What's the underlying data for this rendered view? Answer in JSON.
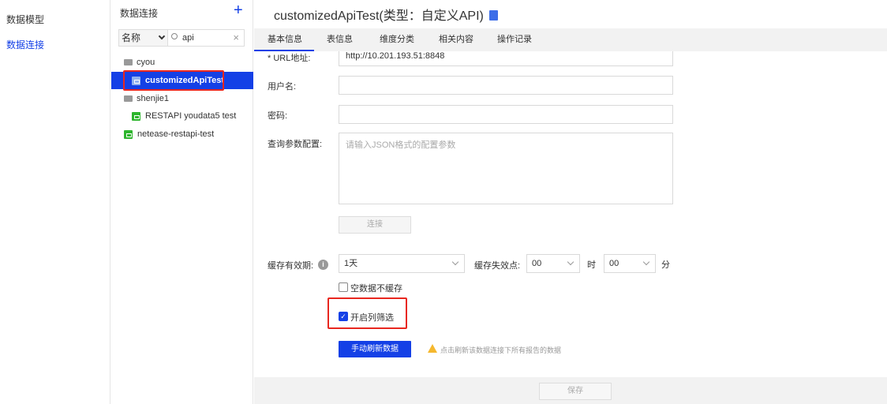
{
  "nav": {
    "items": [
      {
        "label": "数据模型",
        "active": false
      },
      {
        "label": "数据连接",
        "active": true
      }
    ]
  },
  "tree": {
    "title": "数据连接",
    "add_icon": "plus-icon",
    "filter_select": "名称",
    "search_value": "api",
    "nodes": [
      {
        "label": "cyou",
        "type": "folder"
      },
      {
        "label": "customizedApiTest",
        "type": "api",
        "selected": true
      },
      {
        "label": "shenjie1",
        "type": "folder"
      },
      {
        "label": "RESTAPI youdata5 test",
        "type": "datasource"
      },
      {
        "label": "netease-restapi-test",
        "type": "datasource"
      }
    ]
  },
  "main": {
    "title": "customizedApiTest(类型：自定义API)",
    "tabs": [
      "基本信息",
      "表信息",
      "维度分类",
      "相关内容",
      "操作记录"
    ],
    "form": {
      "url_label": "* URL地址:",
      "url_value": "http://10.201.193.51:8848",
      "username_label": "用户名:",
      "password_label": "密码:",
      "query_label": "查询参数配置:",
      "query_placeholder": "请输入JSON格式的配置参数",
      "connect_button": "连接",
      "cache_label": "缓存有效期:",
      "cache_value": "1天",
      "expire_label": "缓存失效点:",
      "hour_value": "00",
      "hour_unit": "时",
      "minute_value": "00",
      "minute_unit": "分",
      "no_cache_empty": "空数据不缓存",
      "no_cache_empty_checked": false,
      "column_filter": "开启列筛选",
      "column_filter_checked": true,
      "refresh_button": "手动刷新数据",
      "refresh_hint": "点击刷新该数据连接下所有报告的数据"
    },
    "save_button": "保存"
  },
  "colors": {
    "accent": "#1440e6",
    "highlight": "#e8271f"
  }
}
